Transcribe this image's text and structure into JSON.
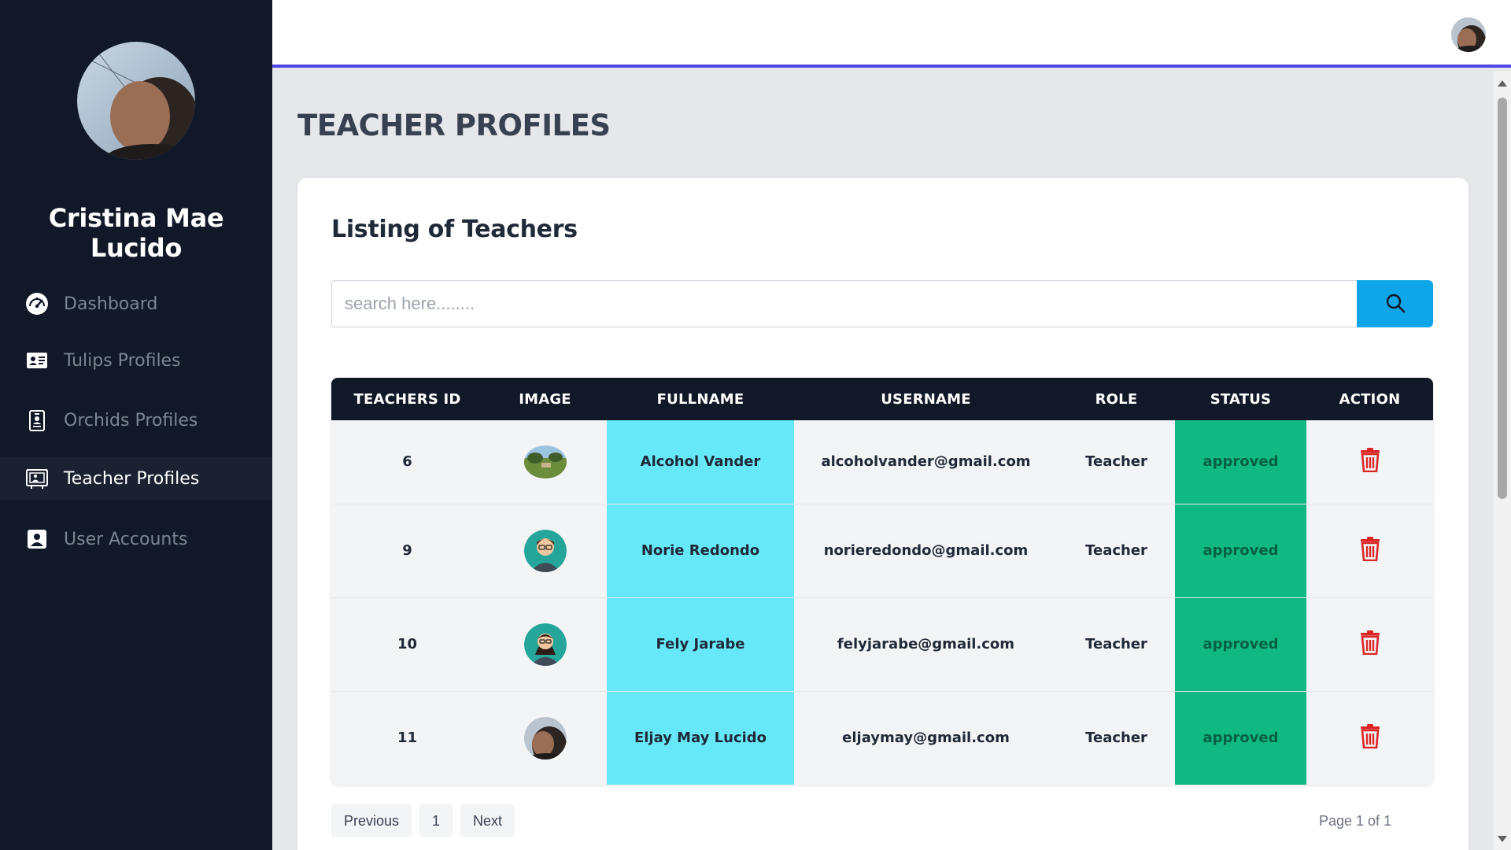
{
  "sidebar": {
    "user_name": "Cristina Mae Lucido",
    "items": [
      {
        "label": "Dashboard",
        "icon": "speedometer-icon",
        "active": false
      },
      {
        "label": "Tulips Profiles",
        "icon": "id-card-icon",
        "active": false
      },
      {
        "label": "Orchids Profiles",
        "icon": "id-badge-icon",
        "active": false
      },
      {
        "label": "Teacher Profiles",
        "icon": "presentation-icon",
        "active": true
      },
      {
        "label": "User Accounts",
        "icon": "person-square-icon",
        "active": false
      }
    ]
  },
  "page": {
    "title": "TEACHER PROFILES",
    "card_title": "Listing of Teachers"
  },
  "search": {
    "placeholder": "search here........",
    "value": "",
    "button_icon": "search-icon"
  },
  "table": {
    "columns": [
      "TEACHERS ID",
      "IMAGE",
      "FULLNAME",
      "USERNAME",
      "ROLE",
      "STATUS",
      "ACTION"
    ],
    "rows": [
      {
        "id": "6",
        "image": "landscape-photo",
        "fullname": "Alcohol Vander",
        "username": "alcoholvander@gmail.com",
        "role": "Teacher",
        "status": "approved",
        "action_icon": "trash-icon"
      },
      {
        "id": "9",
        "image": "male-avatar",
        "fullname": "Norie Redondo",
        "username": "norieredondo@gmail.com",
        "role": "Teacher",
        "status": "approved",
        "action_icon": "trash-icon"
      },
      {
        "id": "10",
        "image": "female-avatar",
        "fullname": "Fely Jarabe",
        "username": "felyjarabe@gmail.com",
        "role": "Teacher",
        "status": "approved",
        "action_icon": "trash-icon"
      },
      {
        "id": "11",
        "image": "selfie-photo",
        "fullname": "Eljay May Lucido",
        "username": "eljaymay@gmail.com",
        "role": "Teacher",
        "status": "approved",
        "action_icon": "trash-icon"
      }
    ]
  },
  "pagination": {
    "previous_label": "Previous",
    "current_page": "1",
    "next_label": "Next",
    "page_info": "Page 1 of 1"
  },
  "colors": {
    "sidebar_bg": "#111827",
    "accent_line": "#4f46e5",
    "search_button": "#0ea5e9",
    "fullname_bg": "#67e8f9",
    "status_bg": "#10b981",
    "delete_icon": "#dc2626"
  }
}
